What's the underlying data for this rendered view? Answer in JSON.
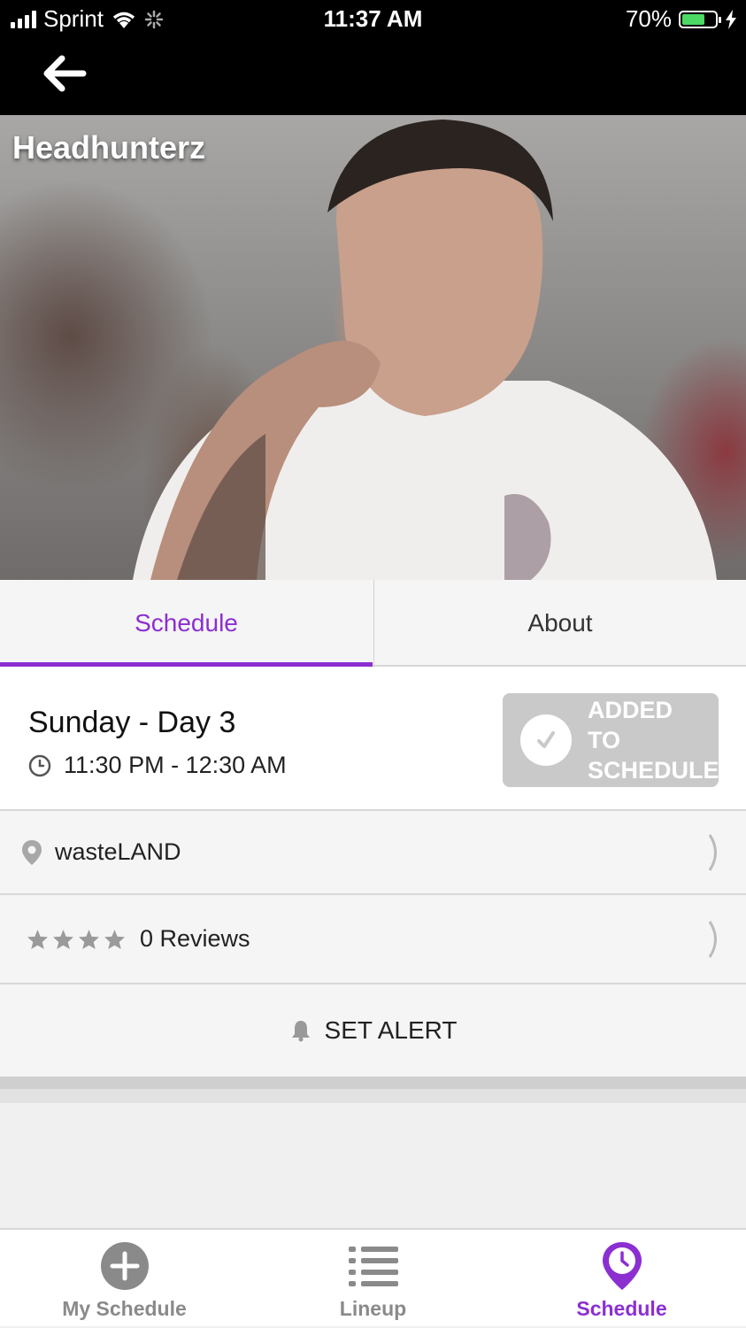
{
  "status_bar": {
    "carrier": "Sprint",
    "time": "11:37 AM",
    "battery_percent": "70%",
    "battery_level": 0.7,
    "icons": [
      "signal-icon",
      "wifi-icon",
      "activity-spinner-icon",
      "battery-icon",
      "charging-bolt-icon"
    ]
  },
  "header": {
    "back_icon": "arrow-left-icon"
  },
  "artist": {
    "name": "Headhunterz"
  },
  "tabs": [
    {
      "label": "Schedule",
      "active": true
    },
    {
      "label": "About",
      "active": false
    }
  ],
  "performance": {
    "day": "Sunday - Day 3",
    "time_range": "11:30 PM - 12:30 AM",
    "schedule_button": "ADDED TO SCHEDULE"
  },
  "location": {
    "name": "wasteLAND"
  },
  "reviews": {
    "label": "0 Reviews",
    "stars": 0,
    "max_stars": 4
  },
  "alert": {
    "label": "SET ALERT"
  },
  "bottom_nav": [
    {
      "label": "My Schedule",
      "icon": "plus-circle-icon",
      "active": false
    },
    {
      "label": "Lineup",
      "icon": "list-icon",
      "active": false
    },
    {
      "label": "Schedule",
      "icon": "clock-pin-icon",
      "active": true
    }
  ],
  "colors": {
    "accent": "#8c2fd1",
    "button_disabled": "#c9c9c9",
    "status_bar": "#000000"
  }
}
